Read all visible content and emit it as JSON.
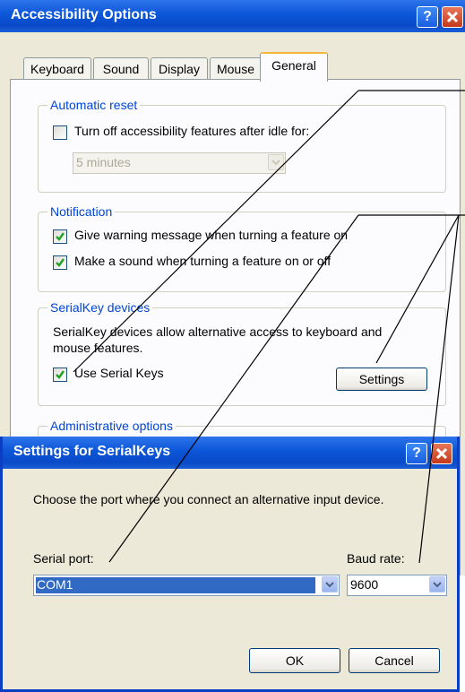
{
  "main_window": {
    "title": "Accessibility Options",
    "help_button": "?",
    "tabs": [
      "Keyboard",
      "Sound",
      "Display",
      "Mouse",
      "General"
    ],
    "active_tab": "General",
    "automatic_reset": {
      "legend": "Automatic reset",
      "checkbox_label": "Turn off accessibility features after idle for:",
      "checked": false,
      "dropdown_value": "5 minutes"
    },
    "notification": {
      "legend": "Notification",
      "warning_label": "Give warning message when turning a feature on",
      "warning_checked": true,
      "sound_label": "Make a sound when turning a feature on or off",
      "sound_checked": true
    },
    "serialkey": {
      "legend": "SerialKey devices",
      "desc_line1": "SerialKey devices allow alternative access to keyboard and",
      "desc_line2": "mouse features.",
      "use_label": "Use Serial Keys",
      "use_checked": true,
      "settings_button": "Settings"
    },
    "admin": {
      "legend": "Administrative options"
    }
  },
  "dialog": {
    "title": "Settings for SerialKeys",
    "help_button": "?",
    "description": "Choose the port where you connect an alternative input device.",
    "serial_port_label": "Serial port:",
    "serial_port_value": "COM1",
    "baud_rate_label": "Baud rate:",
    "baud_rate_value": "9600",
    "ok_button": "OK",
    "cancel_button": "Cancel"
  },
  "colors": {
    "title_blue": "#0b56d8",
    "legend_blue": "#0046d5",
    "close_red": "#c5381a",
    "tab_highlight": "#f7b53b"
  }
}
